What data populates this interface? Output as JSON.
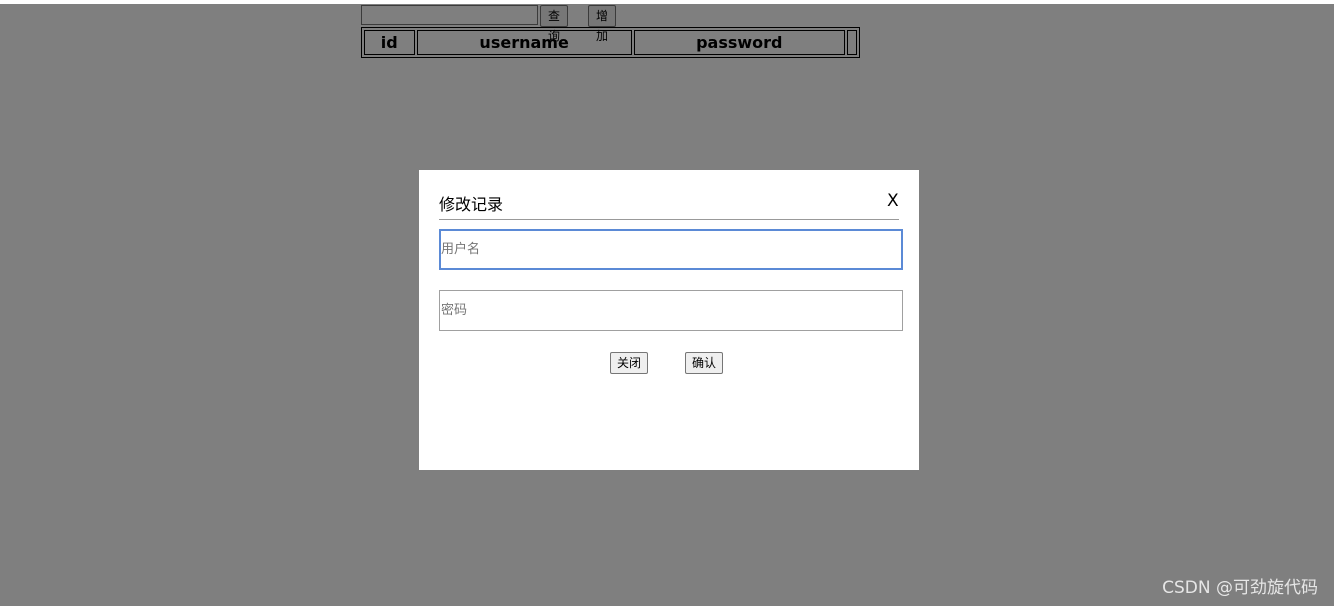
{
  "toolbar": {
    "search_value": "",
    "query_label": "查询",
    "add_label": "增加"
  },
  "table": {
    "headers": [
      "id",
      "username",
      "password",
      ""
    ]
  },
  "modal": {
    "title": "修改记录",
    "close_x": "X",
    "username_placeholder": "用户名",
    "username_value": "",
    "password_placeholder": "密码",
    "password_value": "",
    "close_button": "关闭",
    "confirm_button": "确认"
  },
  "watermark": "CSDN @可劲旋代码"
}
